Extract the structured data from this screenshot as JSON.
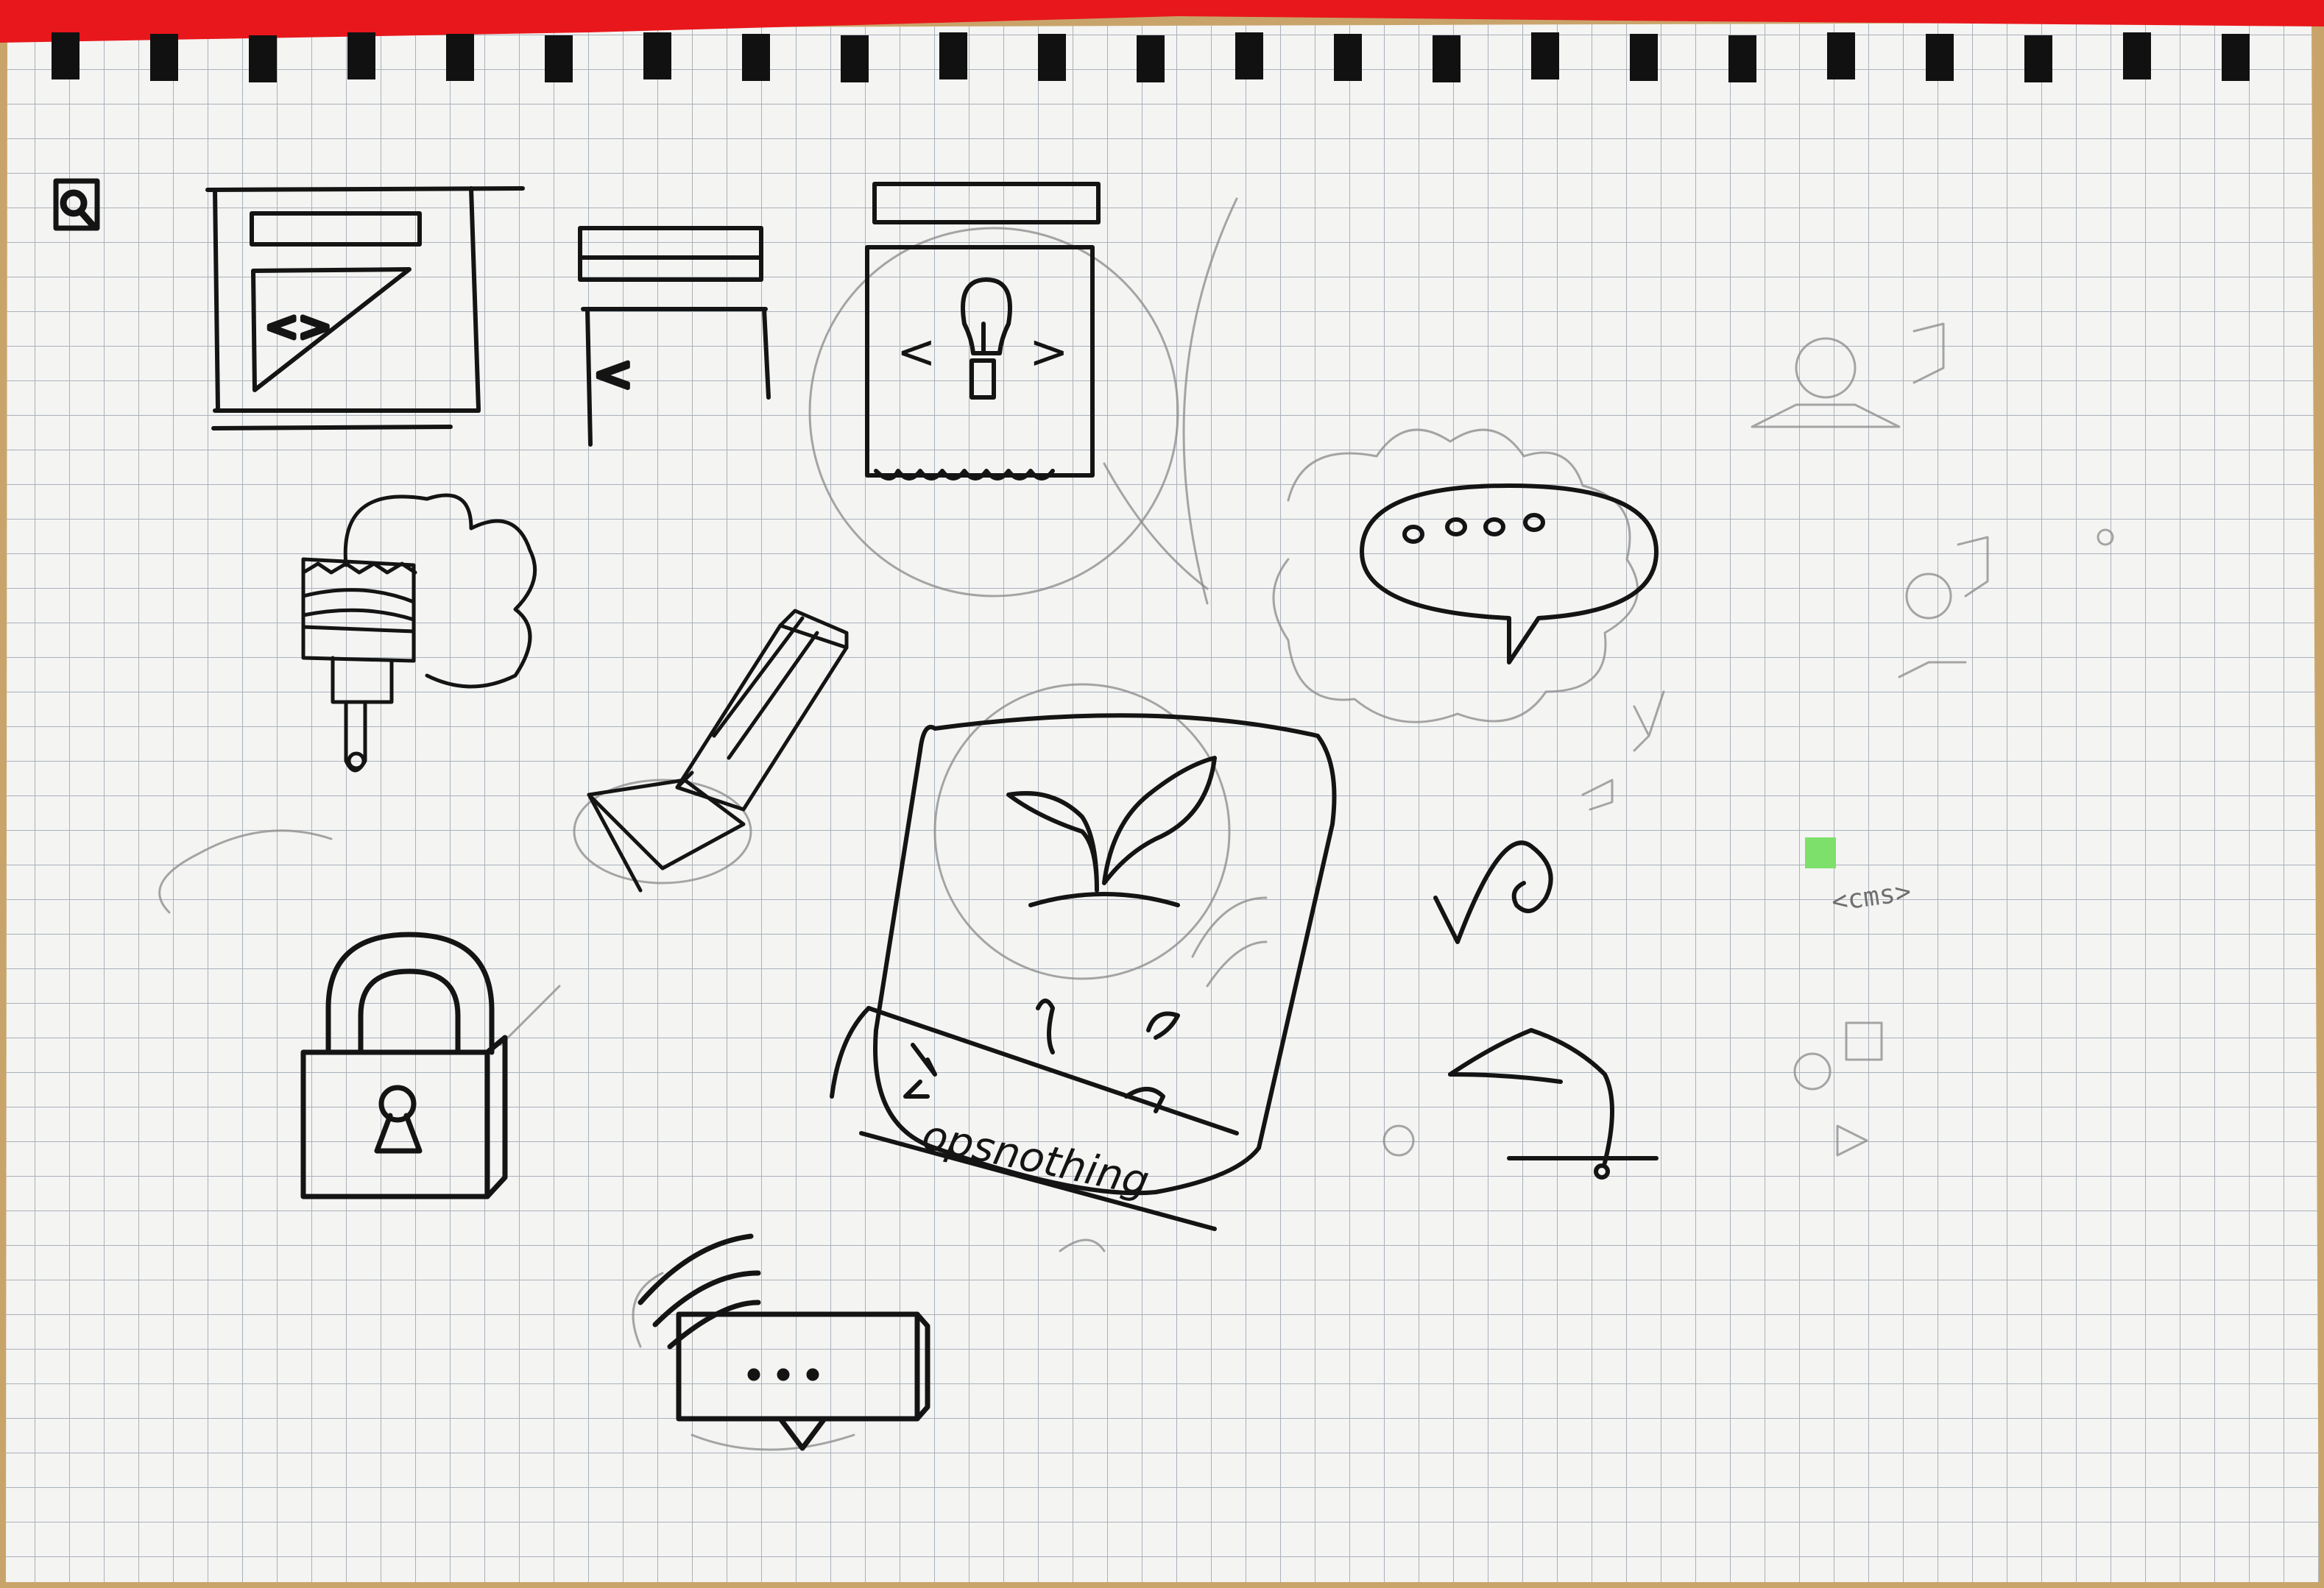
{
  "sketch": {
    "handwritten_word": "opsnothing",
    "pencil_tag": "<cms>",
    "code_brackets": "<>",
    "code_open_bracket": "<",
    "bulb_brackets_left": "<",
    "bulb_brackets_right": ">"
  },
  "colors": {
    "paper": "#f4f4f2",
    "grid": "#9fa8b3",
    "ink": "#141414",
    "pencil": "#8a8a8a",
    "binding_red": "#e8171b",
    "sticky_green": "#7de06a",
    "desk": "#c9a46a"
  },
  "icons": [
    "window-code-icon",
    "window-open-bracket-icon",
    "window-lightbulb-icon",
    "paintbrush-icon",
    "pencil-eraser-icon",
    "padlock-icon",
    "chat-bubble-dots-icon",
    "plant-sprout-card-icon",
    "checkmark-swirl-icon",
    "speech-bubbles-pencil-icon",
    "sound-waves-message-icon",
    "hill-flag-icon",
    "circle-square-triangle-icon"
  ]
}
